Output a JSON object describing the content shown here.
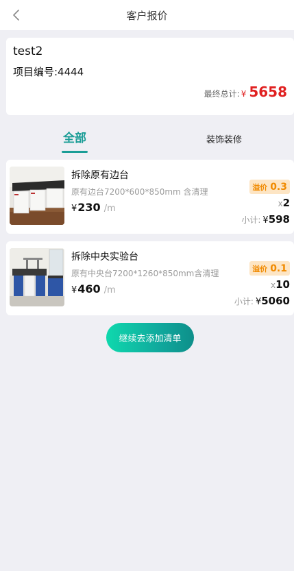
{
  "header": {
    "title": "客户报价"
  },
  "summary": {
    "name": "test2",
    "project_code": "项目编号:4444",
    "total_label": "最终总计:",
    "currency": "¥",
    "total_amount": "5658"
  },
  "tabs": [
    {
      "label": "全部",
      "active": true
    },
    {
      "label": "装饰装修",
      "active": false
    }
  ],
  "items": [
    {
      "name": "拆除原有边台",
      "desc": "原有边台7200*600*850mm 含清理",
      "currency": "¥",
      "price": "230",
      "unit": "/m",
      "premium_label": "溢价",
      "premium_value": "0.3",
      "qty_prefix": "x",
      "qty": "2",
      "subtotal_label": "小计:",
      "subtotal_currency": "¥",
      "subtotal": "598"
    },
    {
      "name": "拆除中央实验台",
      "desc": "原有中央台7200*1260*850mm含清理",
      "currency": "¥",
      "price": "460",
      "unit": "/m",
      "premium_label": "溢价",
      "premium_value": "0.1",
      "qty_prefix": "x",
      "qty": "10",
      "subtotal_label": "小计:",
      "subtotal_currency": "¥",
      "subtotal": "5060"
    }
  ],
  "actions": {
    "continue_label": "继续去添加清单"
  },
  "colors": {
    "accent": "#1a9d96",
    "price_red": "#e02020",
    "premium_orange": "#f08a00"
  }
}
